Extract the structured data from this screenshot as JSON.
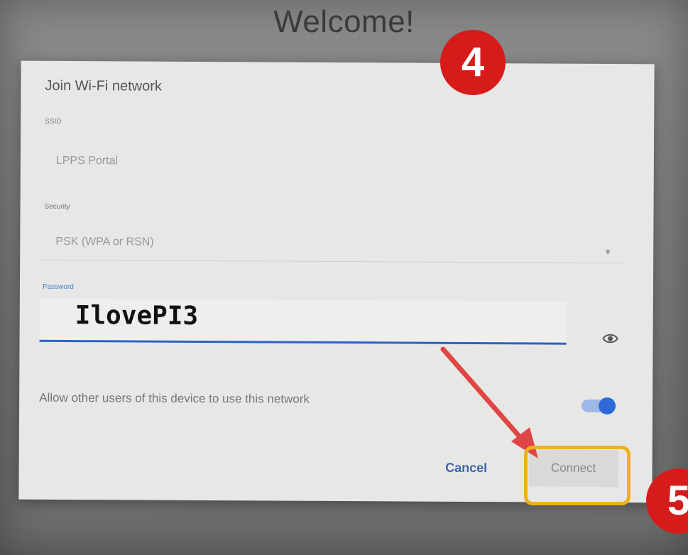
{
  "header": {
    "title": "Welcome!"
  },
  "dialog": {
    "title": "Join Wi-Fi network",
    "ssid": {
      "label": "SSID",
      "value": "LPPS Portal"
    },
    "security": {
      "label": "Security",
      "value": "PSK (WPA or RSN)"
    },
    "password": {
      "label": "Password",
      "value": "IlovePI3"
    },
    "allow_shared": {
      "label": "Allow other users of this device to use this network",
      "enabled": true
    },
    "buttons": {
      "cancel": "Cancel",
      "connect": "Connect"
    }
  },
  "annotations": {
    "step4": "4",
    "step5": "5",
    "badge_color": "#d61b1b",
    "highlight_color": "#f0b01e",
    "arrow_color": "#e04545"
  },
  "colors": {
    "accent": "#2f6bd8",
    "link": "#3c65b0"
  }
}
